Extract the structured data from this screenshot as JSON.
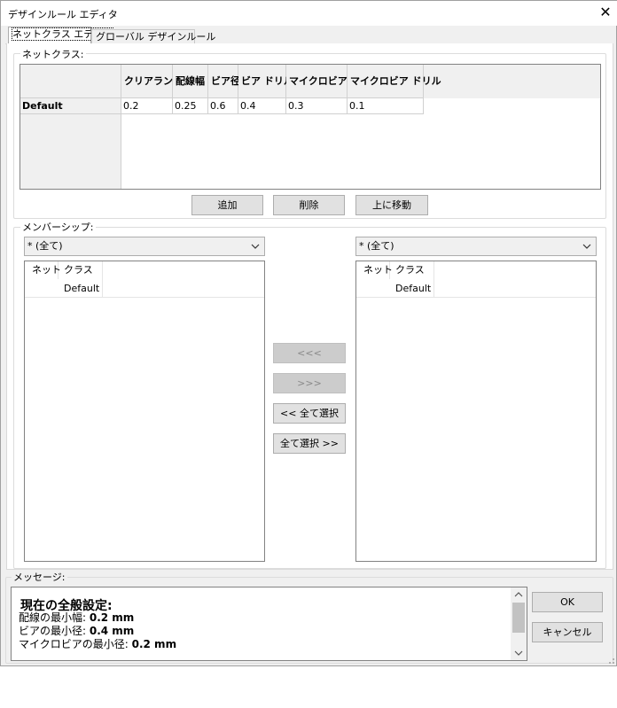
{
  "window": {
    "title": "デザインルール エディタ",
    "close_glyph": "✕"
  },
  "tabs": [
    {
      "label": "ネットクラス エディタ",
      "active": true
    },
    {
      "label": "グローバル デザインルール",
      "active": false
    }
  ],
  "netclasses": {
    "legend": "ネットクラス:",
    "columns": [
      "クリアランス",
      "配線幅",
      "ビア径",
      "ビア ドリル",
      "マイクロビア径",
      "マイクロビア ドリル"
    ],
    "rows": [
      {
        "name": "Default",
        "values": [
          "0.2",
          "0.25",
          "0.6",
          "0.4",
          "0.3",
          "0.1"
        ]
      }
    ],
    "buttons": {
      "add": "追加",
      "delete": "削除",
      "move_up": "上に移動"
    }
  },
  "membership": {
    "legend": "メンバーシップ:",
    "left_filter": "* (全て)",
    "right_filter": "* (全て)",
    "list_headers": [
      "ネット",
      "クラス"
    ],
    "left_items": [
      {
        "net": "",
        "class": "Default"
      }
    ],
    "right_items": [
      {
        "net": "",
        "class": "Default"
      }
    ],
    "buttons": {
      "move_left": "<<<",
      "move_right": ">>>",
      "select_all_left": "<< 全て選択",
      "select_all_right": "全て選択 >>"
    }
  },
  "messages": {
    "legend": "メッセージ:",
    "heading": "現在の全般設定:",
    "lines": [
      {
        "label": "配線の最小幅: ",
        "value": "0.2 mm"
      },
      {
        "label": "ビアの最小径: ",
        "value": "0.4 mm"
      },
      {
        "label": "マイクロビアの最小径: ",
        "value": "0.2 mm"
      }
    ]
  },
  "dialog_buttons": {
    "ok": "OK",
    "cancel": "キャンセル"
  },
  "icons": {
    "close": "close-icon",
    "dropdown": "chevron-down-icon",
    "scroll_up": "chevron-up-icon",
    "scroll_down": "chevron-down-icon"
  }
}
